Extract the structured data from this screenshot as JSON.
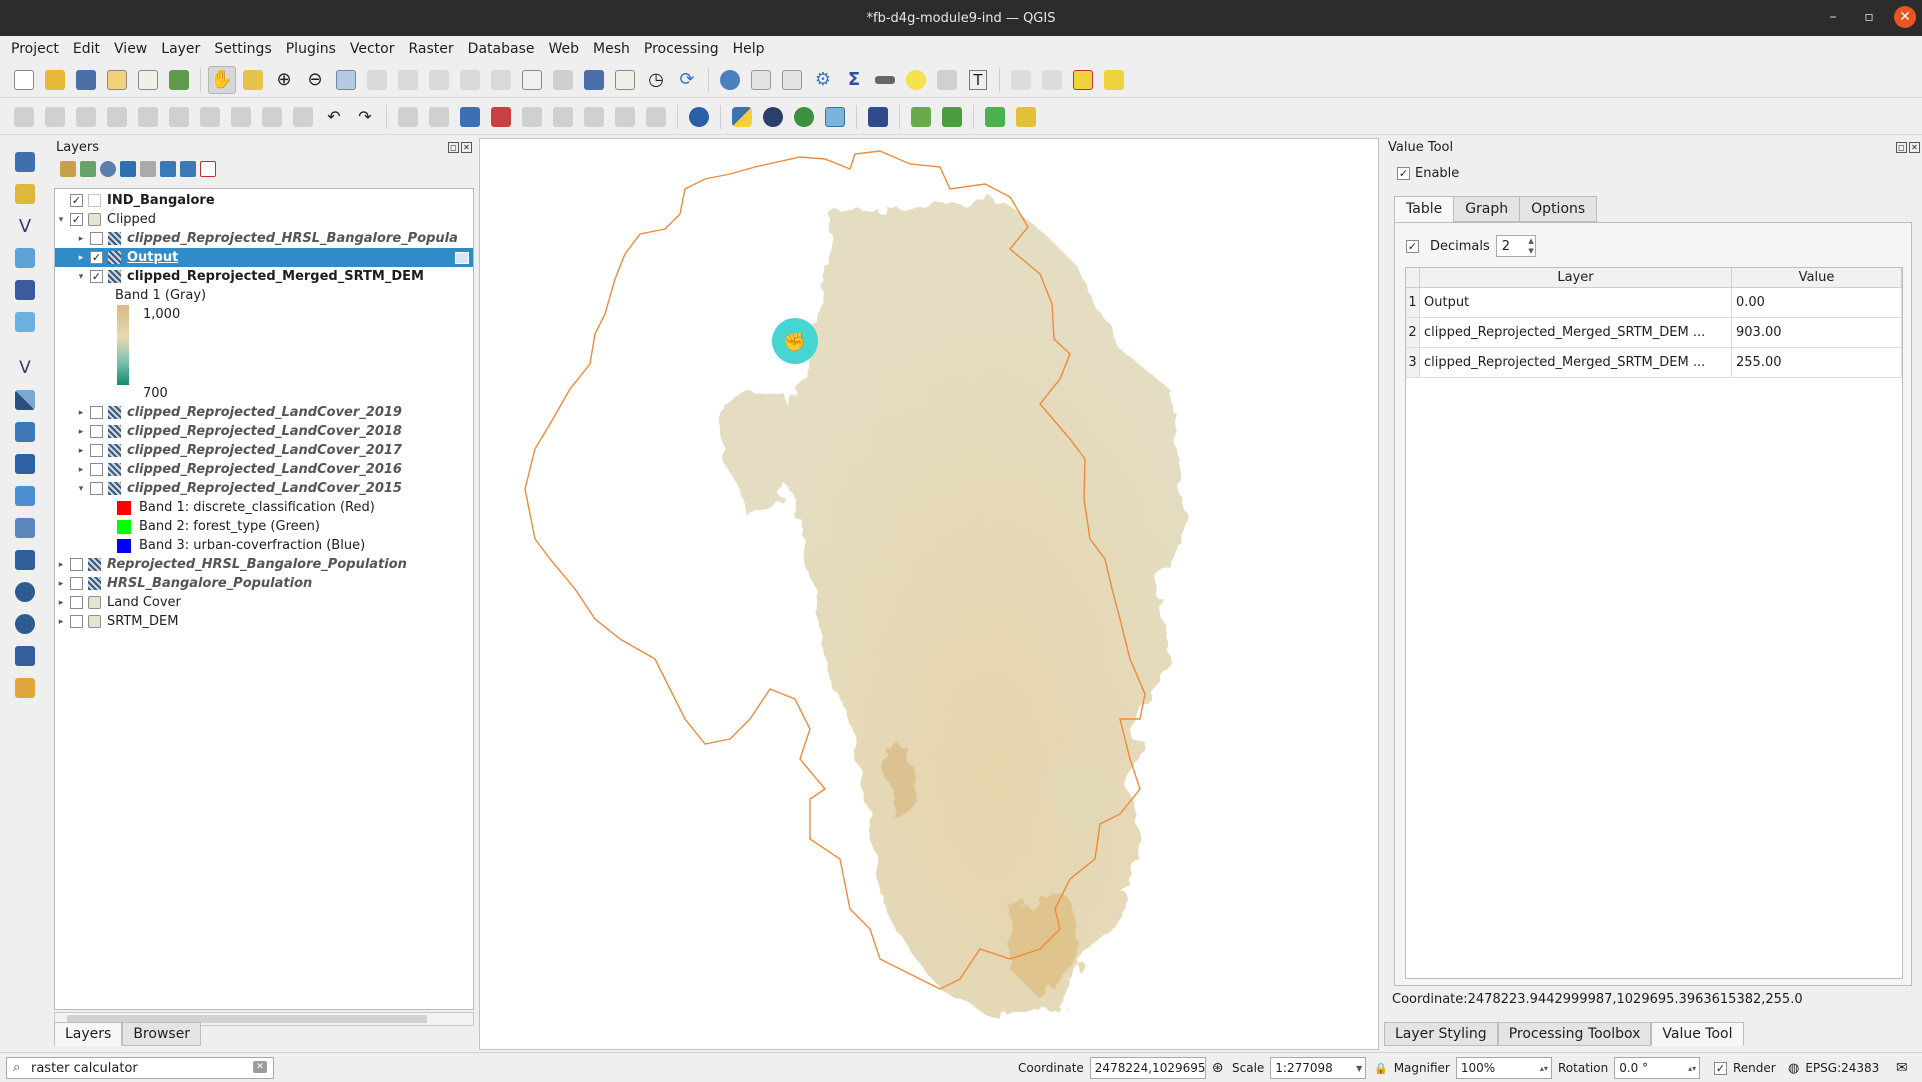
{
  "window": {
    "title": "*fb-d4g-module9-ind — QGIS"
  },
  "menu": [
    "Project",
    "Edit",
    "View",
    "Layer",
    "Settings",
    "Plugins",
    "Vector",
    "Raster",
    "Database",
    "Web",
    "Mesh",
    "Processing",
    "Help"
  ],
  "layers_panel": {
    "title": "Layers",
    "items": [
      {
        "label": "IND_Bangalore"
      },
      {
        "label": "Clipped"
      },
      {
        "label": "clipped_Reprojected_HRSL_Bangalore_Popula"
      },
      {
        "label": "Output"
      },
      {
        "label": "clipped_Reprojected_Merged_SRTM_DEM"
      },
      {
        "label": "Band 1 (Gray)"
      },
      {
        "label": "1,000"
      },
      {
        "label": "700"
      },
      {
        "label": "clipped_Reprojected_LandCover_2019"
      },
      {
        "label": "clipped_Reprojected_LandCover_2018"
      },
      {
        "label": "clipped_Reprojected_LandCover_2017"
      },
      {
        "label": "clipped_Reprojected_LandCover_2016"
      },
      {
        "label": "clipped_Reprojected_LandCover_2015"
      },
      {
        "label": "Band 1: discrete_classification (Red)"
      },
      {
        "label": "Band 2: forest_type (Green)"
      },
      {
        "label": "Band 3: urban-coverfraction (Blue)"
      },
      {
        "label": "Reprojected_HRSL_Bangalore_Population"
      },
      {
        "label": "HRSL_Bangalore_Population"
      },
      {
        "label": "Land Cover"
      },
      {
        "label": "SRTM_DEM"
      }
    ],
    "tabs": [
      "Layers",
      "Browser"
    ]
  },
  "value_tool": {
    "title": "Value Tool",
    "enable_label": "Enable",
    "tabs": [
      "Table",
      "Graph",
      "Options"
    ],
    "decimals_label": "Decimals",
    "decimals_value": "2",
    "columns": [
      "Layer",
      "Value"
    ],
    "rows": [
      {
        "n": "1",
        "layer": "Output",
        "value": "0.00"
      },
      {
        "n": "2",
        "layer": "clipped_Reprojected_Merged_SRTM_DEM ...",
        "value": "903.00"
      },
      {
        "n": "3",
        "layer": "clipped_Reprojected_Merged_SRTM_DEM ...",
        "value": "255.00"
      }
    ],
    "coordinate": "Coordinate:2478223.9442999987,1029695.3963615382,255.0"
  },
  "right_tabs": [
    "Layer Styling",
    "Processing Toolbox",
    "Value Tool"
  ],
  "statusbar": {
    "search_value": "raster calculator",
    "coordinate_label": "Coordinate",
    "coordinate_value": "2478224,1029695",
    "scale_label": "Scale",
    "scale_value": "1:277098",
    "magnifier_label": "Magnifier",
    "magnifier_value": "100%",
    "rotation_label": "Rotation",
    "rotation_value": "0.0 °",
    "render_label": "Render",
    "crs": "EPSG:24383"
  },
  "colors": {
    "accent_selected": "#308cc6",
    "boundary": "#f08a3a",
    "dem_fill": "#e2d9b9",
    "cursor": "#45d6d4",
    "legend_red": "#ff0000",
    "legend_green": "#00ff00",
    "legend_blue": "#0000ff"
  }
}
